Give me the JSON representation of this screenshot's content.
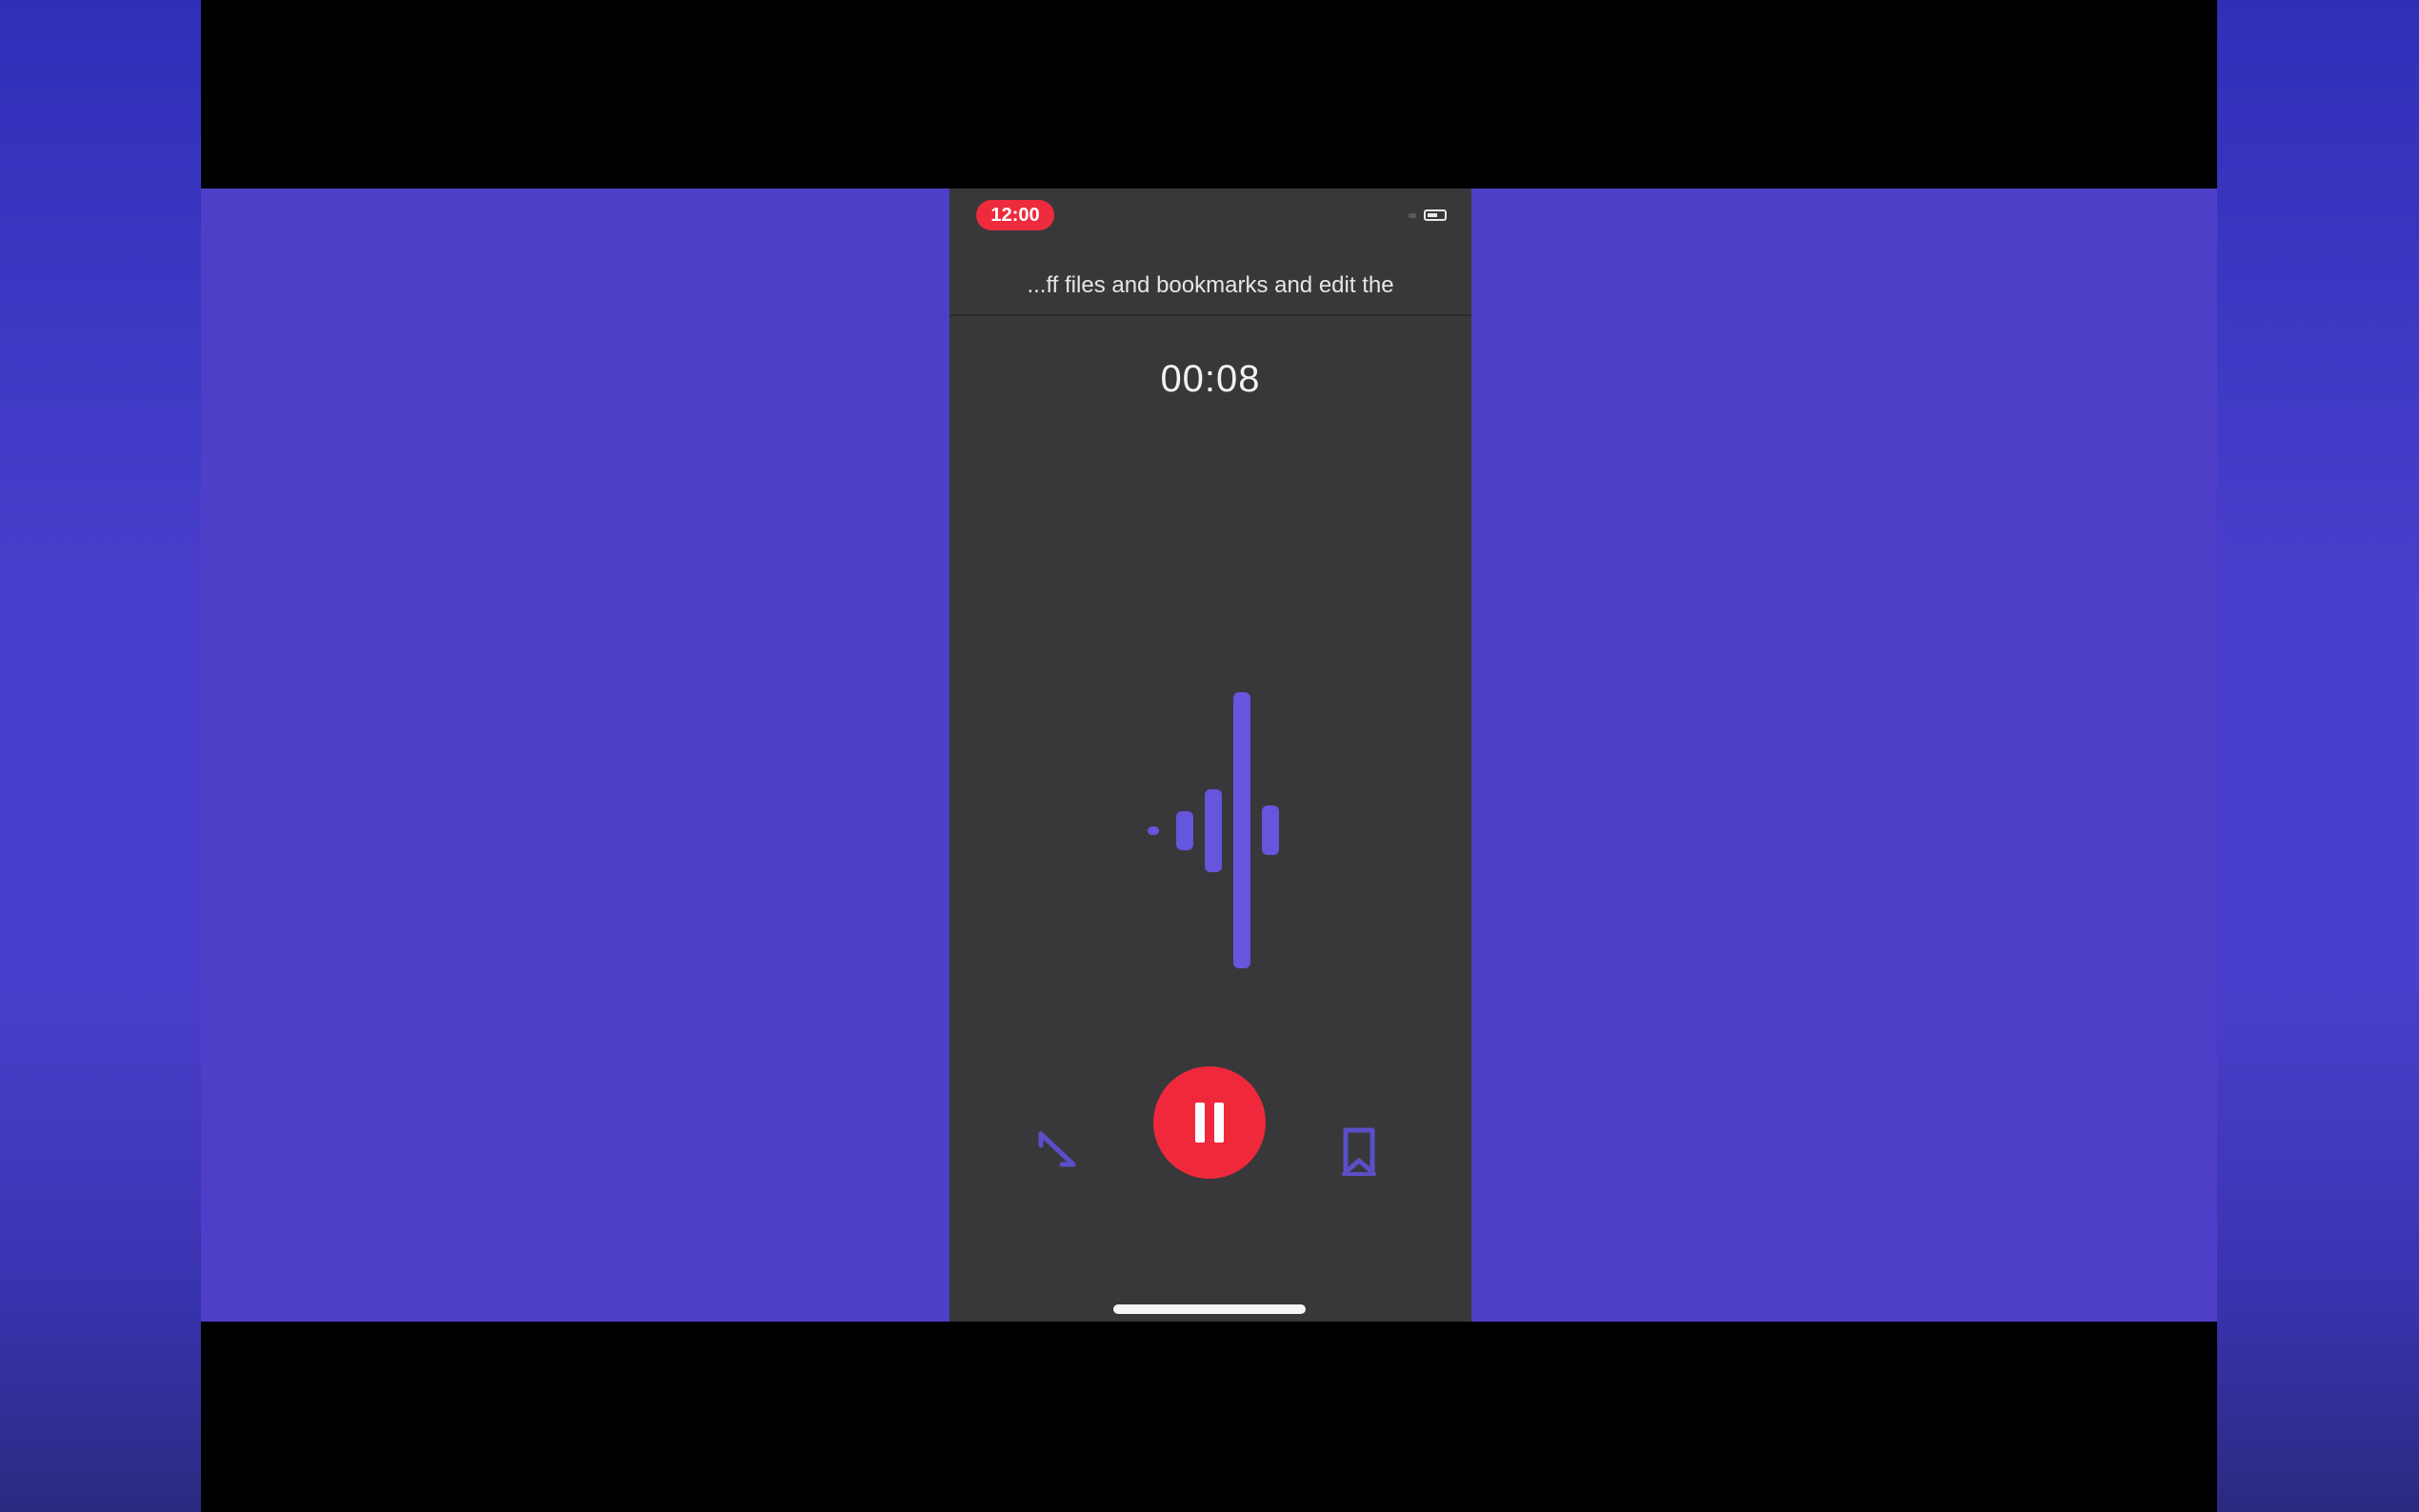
{
  "status_bar": {
    "recording_time": "12:00",
    "recording_color": "#ee2a3d"
  },
  "recording": {
    "title_marquee": "...ff files and bookmarks and edit the",
    "elapsed": "00:08"
  },
  "waveform": {
    "color": "#6655dd",
    "levels": [
      0.03,
      0.14,
      0.3,
      1.0,
      0.18
    ]
  },
  "controls": {
    "pause_icon": "pause-icon",
    "pause_color": "#f0283b",
    "left_icon": "crop-trim-icon",
    "right_icon": "bookmark-icon"
  },
  "colors": {
    "background": "#4d3fc8",
    "phone_bg": "#38383a",
    "accent": "#6655dd"
  }
}
